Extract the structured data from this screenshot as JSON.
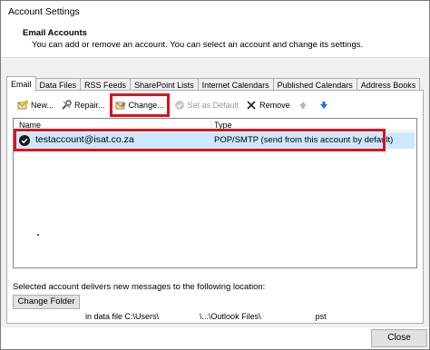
{
  "window": {
    "title": "Account Settings"
  },
  "header": {
    "title": "Email Accounts",
    "subtitle": "You can add or remove an account. You can select an account and change its settings."
  },
  "tabs": [
    {
      "label": "Email",
      "active": true
    },
    {
      "label": "Data Files",
      "active": false
    },
    {
      "label": "RSS Feeds",
      "active": false
    },
    {
      "label": "SharePoint Lists",
      "active": false
    },
    {
      "label": "Internet Calendars",
      "active": false
    },
    {
      "label": "Published Calendars",
      "active": false
    },
    {
      "label": "Address Books",
      "active": false
    }
  ],
  "toolbar": {
    "new_label": "New...",
    "repair_label": "Repair...",
    "change_label": "Change...",
    "default_label": "Set as Default",
    "remove_label": "Remove"
  },
  "accounts_table": {
    "columns": {
      "name": "Name",
      "type": "Type"
    },
    "rows": [
      {
        "name": "testaccount@isat.co.za",
        "type": "POP/SMTP (send from this account by default)",
        "selected": true
      }
    ]
  },
  "delivery": {
    "description": "Selected account delivers new messages to the following location:",
    "change_folder_label": "Change Folder",
    "path_prefix": "in data file C:\\Users\\",
    "path_middle": "\\...\\Outlook Files\\",
    "path_suffix": "pst"
  },
  "footer": {
    "close_label": "Close"
  },
  "colors": {
    "highlight_border": "#d9141f",
    "selected_row": "#cce8ff",
    "arrow_blue": "#1e73d2"
  }
}
